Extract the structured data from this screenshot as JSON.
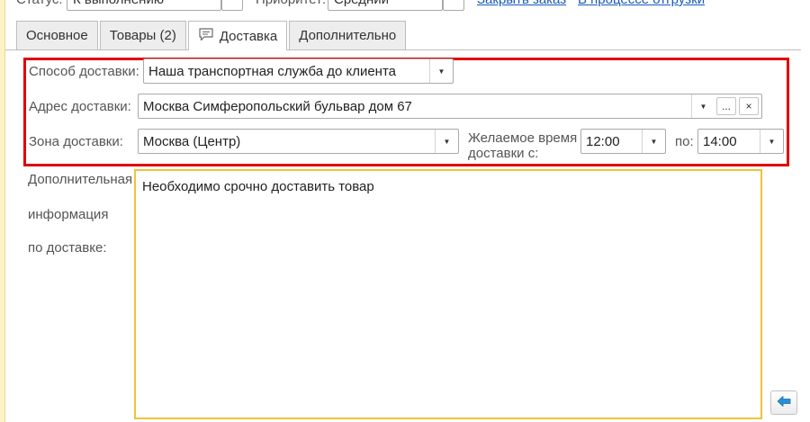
{
  "top_row": {
    "status_label": "Статус:",
    "status_value": "К выполнению",
    "priority_label": "Приоритет:",
    "priority_value": "Средний",
    "link_close": "Закрыть заказ",
    "link_shipping": "В процессе отгрузки"
  },
  "tabs": [
    {
      "label": "Основное",
      "active": false
    },
    {
      "label": "Товары (2)",
      "active": false
    },
    {
      "label": "Доставка",
      "active": true,
      "icon": "comment-icon"
    },
    {
      "label": "Дополнительно",
      "active": false
    }
  ],
  "delivery": {
    "method_label": "Способ доставки:",
    "method_value": "Наша транспортная служба до клиента",
    "address_label": "Адрес доставки:",
    "address_value": "Москва Симферопольский бульвар дом 67",
    "address_select_label": "...",
    "address_clear_label": "×",
    "zone_label": "Зона доставки:",
    "zone_value": "Москва (Центр)",
    "time_label_line1": "Желаемое время",
    "time_label_line2": "доставки с:",
    "time_from": "12:00",
    "time_to_label": "по:",
    "time_to": "14:00"
  },
  "additional": {
    "label_line1": "Дополнительная",
    "label_line2": "информация",
    "label_line3": "по доставке:",
    "text": "Необходимо срочно доставить товар"
  },
  "icons": {
    "dropdown": "chevron-down-icon",
    "corner_button": "arrow-left-icon"
  },
  "colors": {
    "highlight_frame": "#e00000",
    "textarea_border": "#f2c13a",
    "link": "#1a5bb8",
    "corner_icon": "#2b8fd6"
  }
}
